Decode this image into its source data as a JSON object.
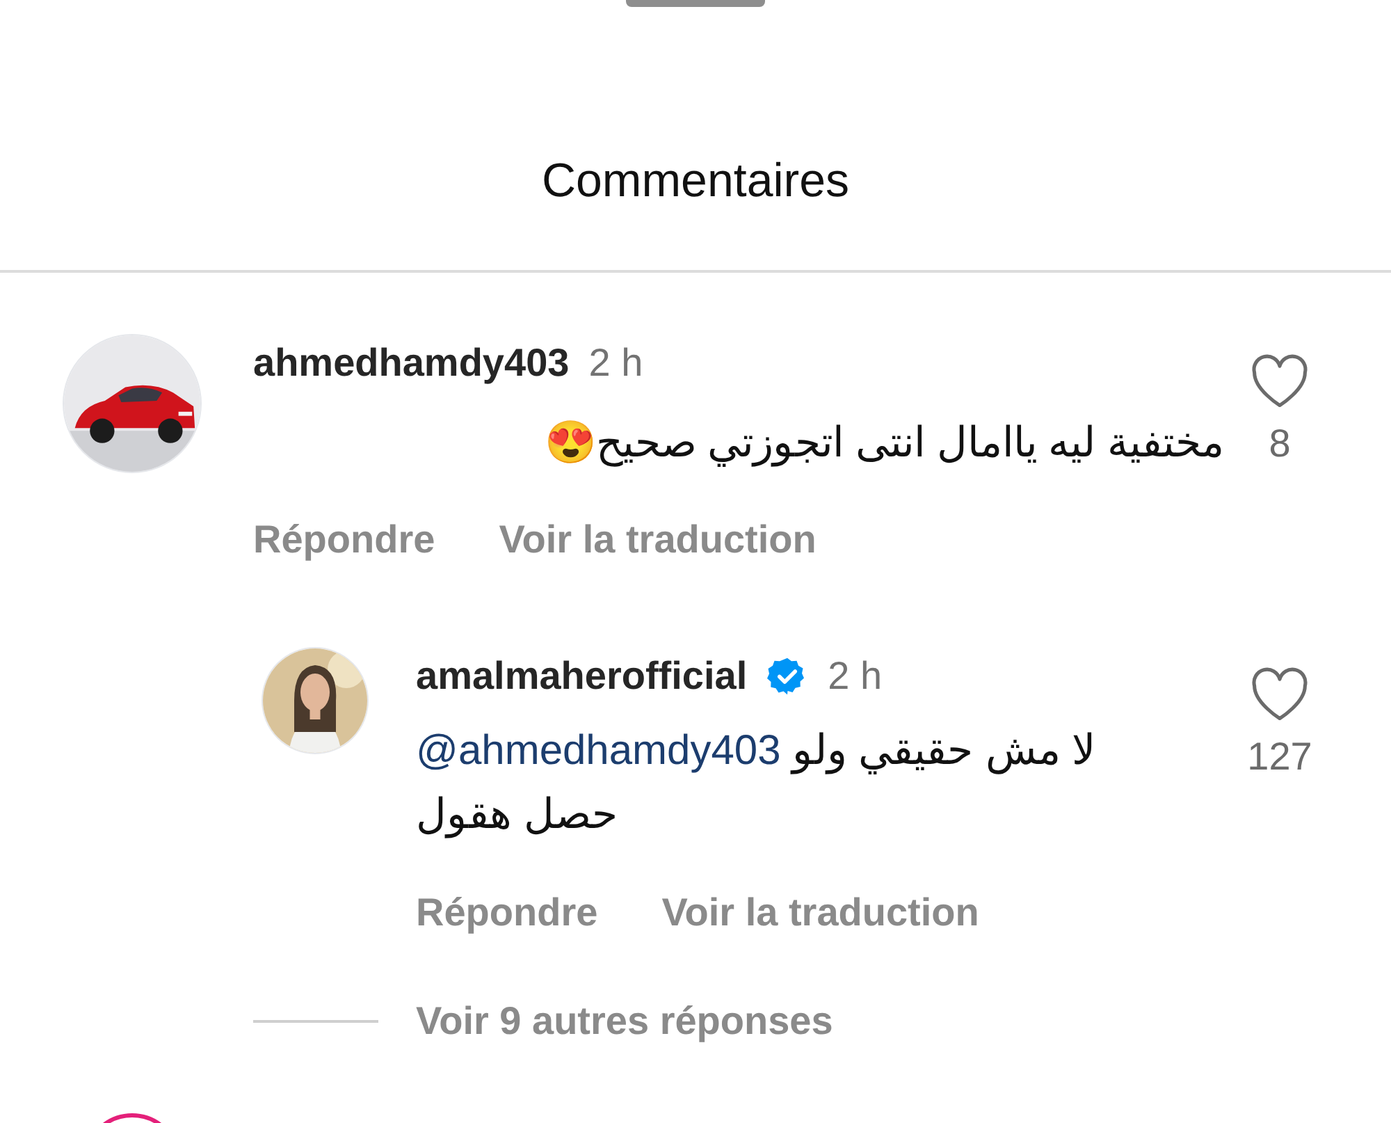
{
  "title": "Commentaires",
  "comments": [
    {
      "username": "ahmedhamdy403",
      "verified": false,
      "time": "2 h",
      "text": "مختفية ليه ياامال انتى اتجوزتي صحيح😍",
      "likes": "8",
      "actions": [
        "Répondre",
        "Voir la traduction"
      ],
      "replies": [
        {
          "username": "amalmaherofficial",
          "verified": true,
          "time": "2 h",
          "mention": "@ahmedhamdy403",
          "text": "لا مش حقيقي ولو حصل هقول",
          "likes": "127",
          "actions": [
            "Répondre",
            "Voir la traduction"
          ]
        }
      ],
      "more_replies": "Voir 9 autres réponses"
    }
  ]
}
